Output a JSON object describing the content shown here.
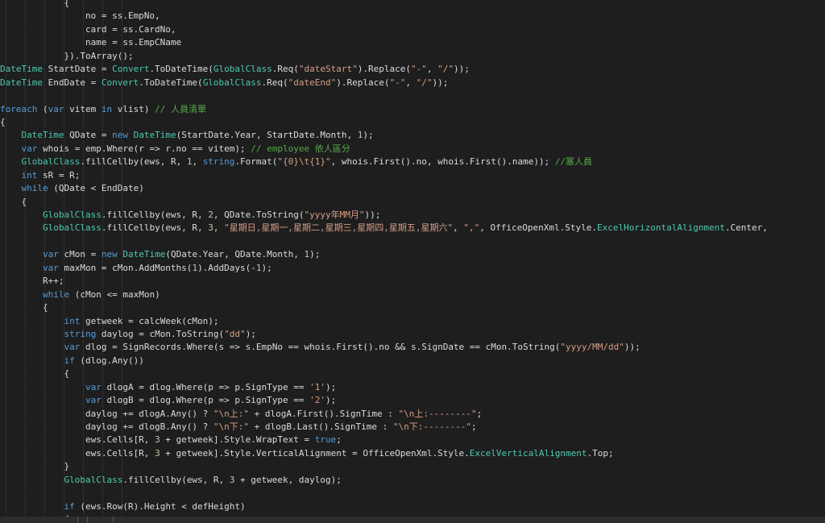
{
  "lines": [
    [
      {
        "t": "            {"
      }
    ],
    [
      {
        "t": "                no = ss.EmpNo,"
      }
    ],
    [
      {
        "t": "                card = ss.CardNo,"
      }
    ],
    [
      {
        "t": "                name = ss.EmpCName"
      }
    ],
    [
      {
        "t": "            }).ToArray();"
      }
    ],
    [
      {
        "c": "ty",
        "t": "DateTime"
      },
      {
        "t": " StartDate = "
      },
      {
        "c": "ty",
        "t": "Convert"
      },
      {
        "t": ".ToDateTime("
      },
      {
        "c": "ty",
        "t": "GlobalClass"
      },
      {
        "t": ".Req("
      },
      {
        "c": "st",
        "t": "\"dateStart\""
      },
      {
        "t": ").Replace("
      },
      {
        "c": "st",
        "t": "\"-\""
      },
      {
        "t": ", "
      },
      {
        "c": "st",
        "t": "\"/\""
      },
      {
        "t": "));"
      }
    ],
    [
      {
        "c": "ty",
        "t": "DateTime"
      },
      {
        "t": " EndDate = "
      },
      {
        "c": "ty",
        "t": "Convert"
      },
      {
        "t": ".ToDateTime("
      },
      {
        "c": "ty",
        "t": "GlobalClass"
      },
      {
        "t": ".Req("
      },
      {
        "c": "st",
        "t": "\"dateEnd\""
      },
      {
        "t": ").Replace("
      },
      {
        "c": "st",
        "t": "\"-\""
      },
      {
        "t": ", "
      },
      {
        "c": "st",
        "t": "\"/\""
      },
      {
        "t": "));"
      }
    ],
    [
      {
        "t": ""
      }
    ],
    [
      {
        "c": "kw",
        "t": "foreach"
      },
      {
        "t": " ("
      },
      {
        "c": "kw",
        "t": "var"
      },
      {
        "t": " vitem "
      },
      {
        "c": "kw",
        "t": "in"
      },
      {
        "t": " vlist) "
      },
      {
        "c": "cm",
        "t": "// 人員清單"
      }
    ],
    [
      {
        "t": "{"
      }
    ],
    [
      {
        "t": "    "
      },
      {
        "c": "ty",
        "t": "DateTime"
      },
      {
        "t": " QDate = "
      },
      {
        "c": "kw",
        "t": "new"
      },
      {
        "t": " "
      },
      {
        "c": "ty",
        "t": "DateTime"
      },
      {
        "t": "(StartDate.Year, StartDate.Month, "
      },
      {
        "c": "nu",
        "t": "1"
      },
      {
        "t": ");"
      }
    ],
    [
      {
        "t": "    "
      },
      {
        "c": "kw",
        "t": "var"
      },
      {
        "t": " whois = emp.Where(r => r.no == vitem); "
      },
      {
        "c": "cm",
        "t": "// employee 依人區分"
      }
    ],
    [
      {
        "t": "    "
      },
      {
        "c": "ty",
        "t": "GlobalClass"
      },
      {
        "t": ".fillCellby(ews, R, "
      },
      {
        "c": "nu",
        "t": "1"
      },
      {
        "t": ", "
      },
      {
        "c": "kw",
        "t": "string"
      },
      {
        "t": ".Format("
      },
      {
        "c": "st",
        "t": "\"{0}\\t{1}\""
      },
      {
        "t": ", whois.First().no, whois.First().name)); "
      },
      {
        "c": "cm",
        "t": "//塞人員"
      }
    ],
    [
      {
        "t": "    "
      },
      {
        "c": "kw",
        "t": "int"
      },
      {
        "t": " sR = R;"
      }
    ],
    [
      {
        "t": "    "
      },
      {
        "c": "kw",
        "t": "while"
      },
      {
        "t": " (QDate < EndDate)"
      }
    ],
    [
      {
        "t": "    {"
      }
    ],
    [
      {
        "t": "        "
      },
      {
        "c": "ty",
        "t": "GlobalClass"
      },
      {
        "t": ".fillCellby(ews, R, "
      },
      {
        "c": "nu",
        "t": "2"
      },
      {
        "t": ", QDate.ToString("
      },
      {
        "c": "st",
        "t": "\"yyyy年MM月\""
      },
      {
        "t": "));"
      }
    ],
    [
      {
        "t": "        "
      },
      {
        "c": "ty",
        "t": "GlobalClass"
      },
      {
        "t": ".fillCellby(ews, R, "
      },
      {
        "c": "nu",
        "t": "3"
      },
      {
        "t": ", "
      },
      {
        "c": "st",
        "t": "\"星期日,星期一,星期二,星期三,星期四,星期五,星期六\""
      },
      {
        "t": ", "
      },
      {
        "c": "st",
        "t": "\",\""
      },
      {
        "t": ", OfficeOpenXml.Style."
      },
      {
        "c": "ty",
        "t": "ExcelHorizontalAlignment"
      },
      {
        "t": ".Center,"
      }
    ],
    [
      {
        "t": ""
      }
    ],
    [
      {
        "t": "        "
      },
      {
        "c": "kw",
        "t": "var"
      },
      {
        "t": " cMon = "
      },
      {
        "c": "kw",
        "t": "new"
      },
      {
        "t": " "
      },
      {
        "c": "ty",
        "t": "DateTime"
      },
      {
        "t": "(QDate.Year, QDate.Month, "
      },
      {
        "c": "nu",
        "t": "1"
      },
      {
        "t": ");"
      }
    ],
    [
      {
        "t": "        "
      },
      {
        "c": "kw",
        "t": "var"
      },
      {
        "t": " maxMon = cMon.AddMonths("
      },
      {
        "c": "nu",
        "t": "1"
      },
      {
        "t": ").AddDays(-"
      },
      {
        "c": "nu",
        "t": "1"
      },
      {
        "t": ");"
      }
    ],
    [
      {
        "t": "        R++;"
      }
    ],
    [
      {
        "t": "        "
      },
      {
        "c": "kw",
        "t": "while"
      },
      {
        "t": " (cMon <= maxMon)"
      }
    ],
    [
      {
        "t": "        {"
      }
    ],
    [
      {
        "t": "            "
      },
      {
        "c": "kw",
        "t": "int"
      },
      {
        "t": " getweek = calcWeek(cMon);"
      }
    ],
    [
      {
        "t": "            "
      },
      {
        "c": "kw",
        "t": "string"
      },
      {
        "t": " daylog = cMon.ToString("
      },
      {
        "c": "st",
        "t": "\"dd\""
      },
      {
        "t": ");"
      }
    ],
    [
      {
        "t": "            "
      },
      {
        "c": "kw",
        "t": "var"
      },
      {
        "t": " dlog = SignRecords.Where(s => s.EmpNo == whois.First().no && s.SignDate == cMon.ToString("
      },
      {
        "c": "st",
        "t": "\"yyyy/MM/dd\""
      },
      {
        "t": "));"
      }
    ],
    [
      {
        "t": "            "
      },
      {
        "c": "kw",
        "t": "if"
      },
      {
        "t": " (dlog.Any())"
      }
    ],
    [
      {
        "t": "            {"
      }
    ],
    [
      {
        "t": "                "
      },
      {
        "c": "kw",
        "t": "var"
      },
      {
        "t": " dlogA = dlog.Where(p => p.SignType == "
      },
      {
        "c": "st",
        "t": "'1'"
      },
      {
        "t": ");"
      }
    ],
    [
      {
        "t": "                "
      },
      {
        "c": "kw",
        "t": "var"
      },
      {
        "t": " dlogB = dlog.Where(p => p.SignType == "
      },
      {
        "c": "st",
        "t": "'2'"
      },
      {
        "t": ");"
      }
    ],
    [
      {
        "t": "                daylog += dlogA.Any() ? "
      },
      {
        "c": "st",
        "t": "\"\\n上:\""
      },
      {
        "t": " + dlogA.First().SignTime : "
      },
      {
        "c": "st",
        "t": "\"\\n上:--------\""
      },
      {
        "t": ";"
      }
    ],
    [
      {
        "t": "                daylog += dlogB.Any() ? "
      },
      {
        "c": "st",
        "t": "\"\\n下:\""
      },
      {
        "t": " + dlogB.Last().SignTime : "
      },
      {
        "c": "st",
        "t": "\"\\n下:--------\""
      },
      {
        "t": ";"
      }
    ],
    [
      {
        "t": "                ews.Cells[R, "
      },
      {
        "c": "nu",
        "t": "3"
      },
      {
        "t": " + getweek].Style.WrapText = "
      },
      {
        "c": "kw",
        "t": "true"
      },
      {
        "t": ";"
      }
    ],
    [
      {
        "t": "                ews.Cells[R, "
      },
      {
        "c": "nu",
        "t": "3"
      },
      {
        "t": " + getweek].Style.VerticalAlignment = OfficeOpenXml.Style."
      },
      {
        "c": "ty",
        "t": "ExcelVerticalAlignment"
      },
      {
        "t": ".Top;"
      }
    ],
    [
      {
        "t": "            }"
      }
    ],
    [
      {
        "t": "            "
      },
      {
        "c": "ty",
        "t": "GlobalClass"
      },
      {
        "t": ".fillCellby(ews, R, "
      },
      {
        "c": "nu",
        "t": "3"
      },
      {
        "t": " + getweek, daylog);"
      }
    ],
    [
      {
        "t": ""
      }
    ],
    [
      {
        "t": "            "
      },
      {
        "c": "kw",
        "t": "if"
      },
      {
        "t": " (ews.Row(R).Height < defHeight)"
      }
    ],
    [
      {
        "t": "            {"
      }
    ]
  ]
}
